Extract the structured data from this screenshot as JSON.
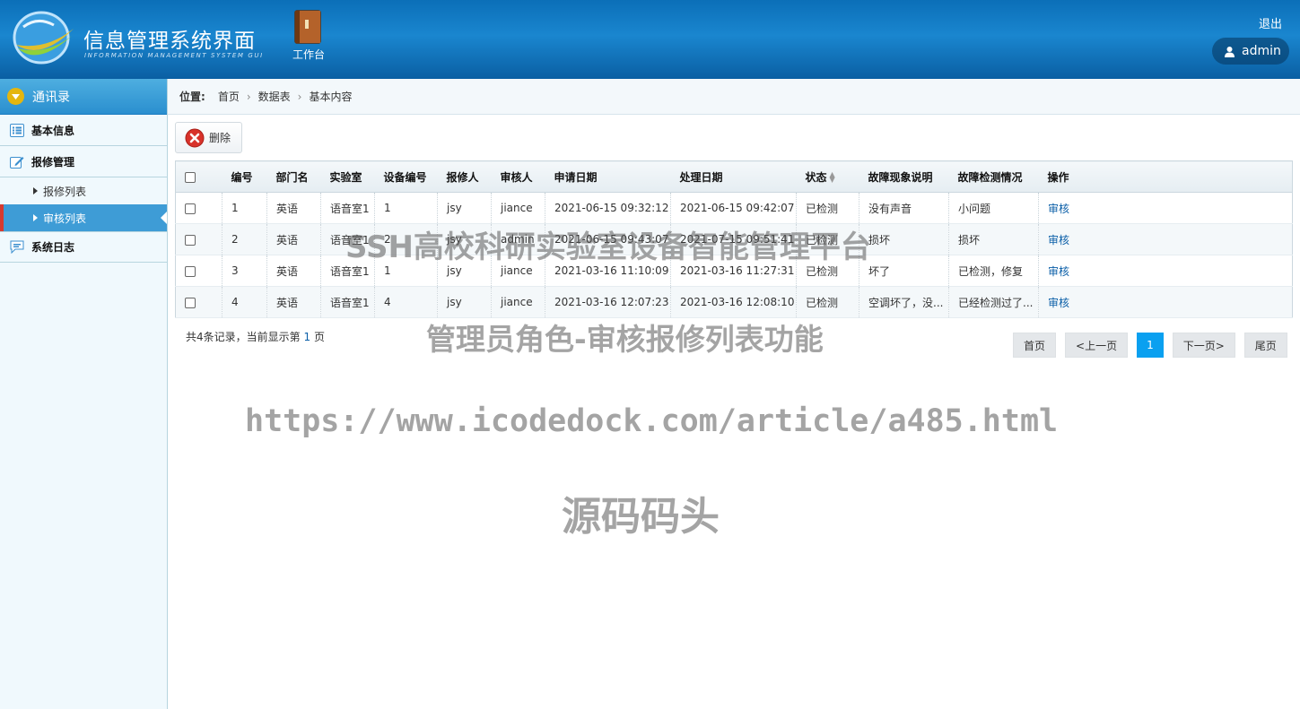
{
  "header": {
    "title": "信息管理系统界面",
    "subtitle": "INFORMATION MANAGEMENT SYSTEM GUI",
    "workbench_label": "工作台",
    "logout_label": "退出",
    "username": "admin"
  },
  "sidebar": {
    "top_label": "通讯录",
    "groups": [
      {
        "label": "基本信息",
        "icon": "list-icon"
      },
      {
        "label": "报修管理",
        "icon": "edit-icon",
        "items": [
          {
            "label": "报修列表",
            "active": false
          },
          {
            "label": "审核列表",
            "active": true
          }
        ]
      },
      {
        "label": "系统日志",
        "icon": "message-icon"
      }
    ]
  },
  "breadcrumb": {
    "prefix": "位置:",
    "items": [
      "首页",
      "数据表",
      "基本内容"
    ]
  },
  "toolbar": {
    "delete_label": "删除"
  },
  "table": {
    "columns": [
      "",
      "编号",
      "部门名",
      "实验室",
      "设备编号",
      "报修人",
      "审核人",
      "申请日期",
      "处理日期",
      "状态",
      "故障现象说明",
      "故障检测情况",
      "操作"
    ],
    "rows": [
      [
        "1",
        "英语",
        "语音室1",
        "1",
        "jsy",
        "jiance",
        "2021-06-15 09:32:12",
        "2021-06-15 09:42:07",
        "已检测",
        "没有声音",
        "小问题",
        "审核"
      ],
      [
        "2",
        "英语",
        "语音室1",
        "2",
        "jsy",
        "admin",
        "2021-06-15 09:43:07",
        "2021-07-15 09:51:41",
        "已检测",
        "损坏",
        "损坏",
        "审核"
      ],
      [
        "3",
        "英语",
        "语音室1",
        "1",
        "jsy",
        "jiance",
        "2021-03-16 11:10:09",
        "2021-03-16 11:27:31",
        "已检测",
        "坏了",
        "已检测，修复",
        "审核"
      ],
      [
        "4",
        "英语",
        "语音室1",
        "4",
        "jsy",
        "jiance",
        "2021-03-16 12:07:23",
        "2021-03-16 12:08:10",
        "已检测",
        "空调坏了，没...",
        "已经检测过了...",
        "审核"
      ]
    ]
  },
  "footer": {
    "record_prefix": "共4条记录，当前显示第",
    "current_page": "1",
    "record_suffix": "页"
  },
  "pager": {
    "first": "首页",
    "prev": "<上一页",
    "current": "1",
    "next": "下一页>",
    "last": "尾页"
  },
  "watermarks": {
    "line1": "SSH高校科研实验室设备智能管理平台",
    "line2": "管理员角色-审核报修列表功能",
    "line3": "https://www.icodedock.com/article/a485.html",
    "line4": "源码码头"
  },
  "colors": {
    "header_blue": "#1a86cf",
    "active_nav": "#3e9cd6",
    "active_marker": "#d63a2f",
    "link": "#0b5fa8",
    "pager_active": "#0aa0f0"
  }
}
